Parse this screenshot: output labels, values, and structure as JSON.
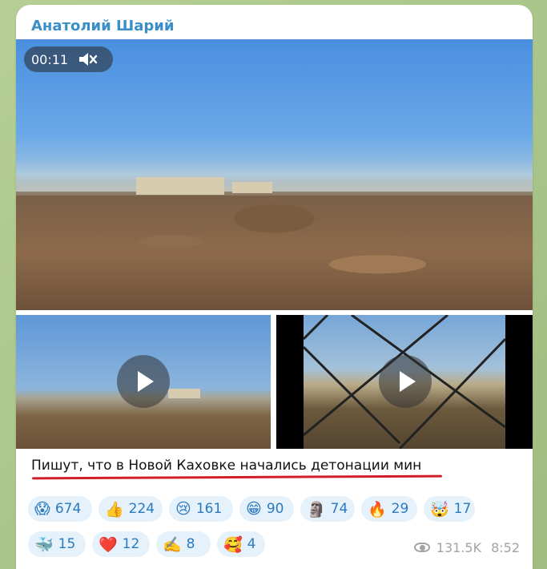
{
  "post": {
    "author": "Анатолий Шарий",
    "video_timer": "00:11",
    "caption": "Пишут, что в Новой Каховке начались детонации мин",
    "views": "131.5K",
    "time": "8:52"
  },
  "reactions": [
    {
      "emoji": "😱",
      "count": "674"
    },
    {
      "emoji": "👍",
      "count": "224"
    },
    {
      "emoji": "😢",
      "count": "161"
    },
    {
      "emoji": "😁",
      "count": "90"
    },
    {
      "emoji": "🗿",
      "count": "74"
    },
    {
      "emoji": "🔥",
      "count": "29"
    },
    {
      "emoji": "🤯",
      "count": "17"
    },
    {
      "emoji": "🐳",
      "count": "15"
    },
    {
      "emoji": "❤️",
      "count": "12"
    },
    {
      "emoji": "✍️",
      "count": "8"
    },
    {
      "emoji": "🥰",
      "count": "4"
    }
  ],
  "colors": {
    "accent": "#3a8fc9",
    "reaction_bg": "#e6f2fb",
    "underline": "#d11f2a"
  },
  "icons": [
    "mute-icon",
    "play-icon",
    "eye-icon"
  ]
}
